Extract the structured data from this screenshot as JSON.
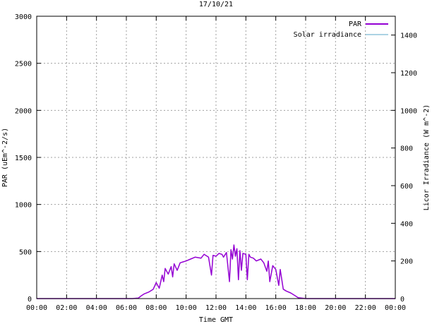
{
  "chart_data": {
    "type": "line",
    "title": "17/10/21",
    "xlabel": "Time GMT",
    "ylabel": "PAR (uEm^-2/s)",
    "y2label": "Licor Irradiance (W m^-2)",
    "xlim": [
      0,
      24
    ],
    "ylim": [
      0,
      3000
    ],
    "y2lim": [
      0,
      1500
    ],
    "x_ticks": [
      0,
      2,
      4,
      6,
      8,
      10,
      12,
      14,
      16,
      18,
      20,
      22,
      24
    ],
    "x_tick_labels": [
      "00:00",
      "02:00",
      "04:00",
      "06:00",
      "08:00",
      "10:00",
      "12:00",
      "14:00",
      "16:00",
      "18:00",
      "20:00",
      "22:00",
      "00:00"
    ],
    "y_ticks": [
      0,
      500,
      1000,
      1500,
      2000,
      2500,
      3000
    ],
    "y_tick_labels": [
      "0",
      "500",
      "1000",
      "1500",
      "2000",
      "2500",
      "3000"
    ],
    "y2_ticks": [
      0,
      200,
      400,
      600,
      800,
      1000,
      1200,
      1400
    ],
    "y2_tick_labels": [
      "0",
      "200",
      "400",
      "600",
      "800",
      "1000",
      "1200",
      "1400"
    ],
    "grid": true,
    "legend_position": "top-right",
    "series": [
      {
        "name": "PAR",
        "color": "#9400d3",
        "axis": "left",
        "x": [
          0,
          6.4,
          6.8,
          7.0,
          7.2,
          7.5,
          7.8,
          8.0,
          8.2,
          8.4,
          8.5,
          8.6,
          8.8,
          9.0,
          9.1,
          9.2,
          9.4,
          9.6,
          9.8,
          10.0,
          10.3,
          10.6,
          11.0,
          11.2,
          11.5,
          11.7,
          11.8,
          12.0,
          12.2,
          12.4,
          12.5,
          12.7,
          12.9,
          13.0,
          13.1,
          13.2,
          13.3,
          13.4,
          13.5,
          13.6,
          13.7,
          13.8,
          14.0,
          14.1,
          14.2,
          14.3,
          14.5,
          14.7,
          15.0,
          15.2,
          15.4,
          15.5,
          15.6,
          15.8,
          16.0,
          16.2,
          16.3,
          16.5,
          16.7,
          17.0,
          17.3,
          17.5,
          18.0,
          24
        ],
        "y": [
          0,
          0,
          5,
          30,
          50,
          70,
          100,
          170,
          110,
          250,
          180,
          320,
          260,
          340,
          230,
          370,
          300,
          380,
          390,
          400,
          420,
          440,
          430,
          470,
          440,
          250,
          460,
          450,
          480,
          470,
          440,
          490,
          180,
          520,
          420,
          570,
          450,
          530,
          200,
          510,
          300,
          480,
          470,
          200,
          470,
          440,
          430,
          400,
          420,
          380,
          290,
          400,
          180,
          350,
          310,
          140,
          310,
          100,
          80,
          60,
          30,
          10,
          0,
          0
        ]
      },
      {
        "name": "Solar irradiance",
        "color": "#5aa7c9",
        "axis": "right",
        "x": [
          0,
          24
        ],
        "y": [
          0,
          0
        ]
      }
    ]
  }
}
